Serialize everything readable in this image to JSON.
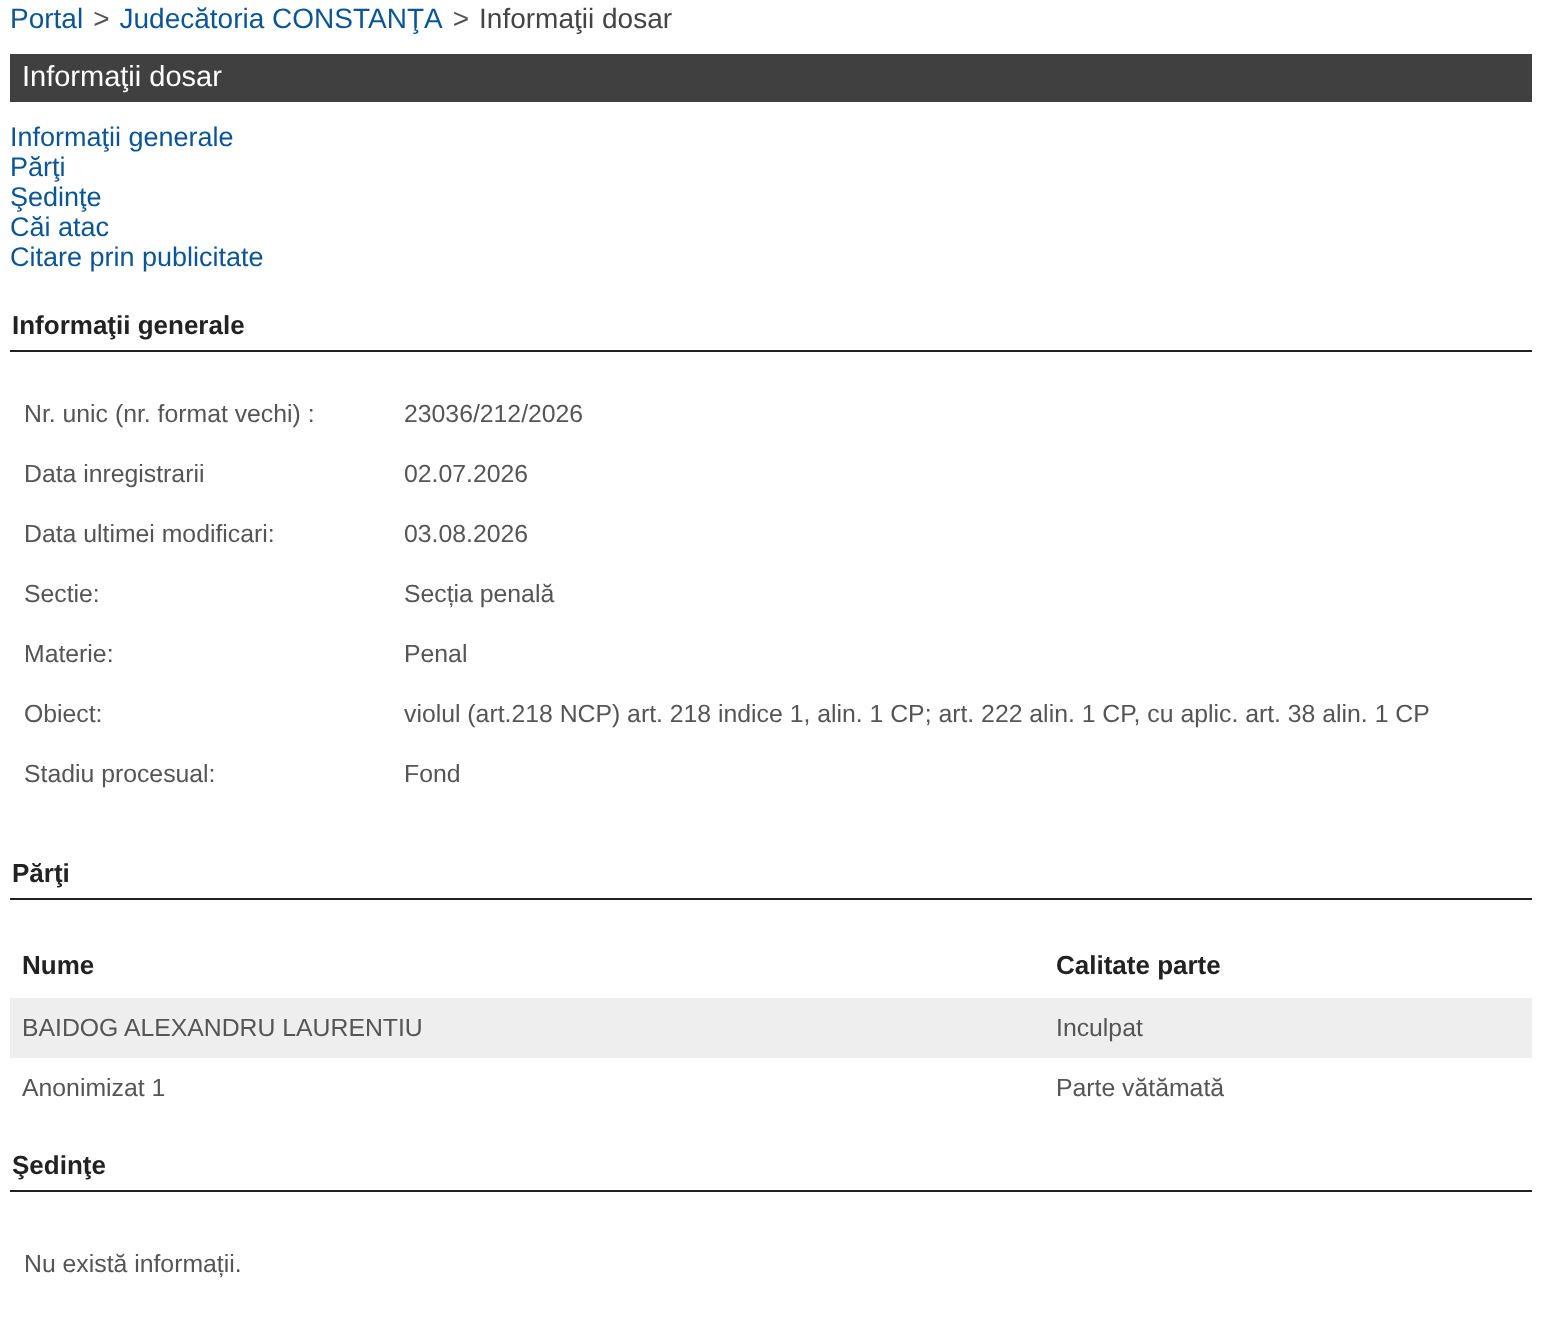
{
  "breadcrumb": [
    {
      "label": "Portal",
      "link": true
    },
    {
      "separator": ">",
      "label": "Judecătoria CONSTANŢA",
      "link": true
    },
    {
      "separator": ">",
      "label": "Informaţii dosar",
      "link": false
    }
  ],
  "title_bar": {
    "title": "Informaţii dosar"
  },
  "section_links": [
    "Informaţii generale",
    "Părţi",
    "Şedinţe",
    "Căi atac",
    "Citare prin publicitate"
  ],
  "general_info": {
    "heading": "Informaţii generale",
    "rows": [
      {
        "label": "Nr. unic (nr. format vechi) :",
        "value": "23036/212/2026"
      },
      {
        "label": "Data inregistrarii",
        "value": "02.07.2026"
      },
      {
        "label": "Data ultimei modificari:",
        "value": "03.08.2026"
      },
      {
        "label": "Sectie:",
        "value": "Secția penală"
      },
      {
        "label": "Materie:",
        "value": "Penal"
      },
      {
        "label": "Obiect:",
        "value": "violul (art.218 NCP) art. 218 indice 1, alin. 1 CP; art. 222 alin. 1 CP, cu aplic. art. 38 alin. 1 CP"
      },
      {
        "label": "Stadiu procesual:",
        "value": "Fond"
      }
    ]
  },
  "parties": {
    "heading": "Părţi",
    "columns": [
      "Nume",
      "Calitate parte"
    ],
    "rows": [
      {
        "cells": [
          "BAIDOG ALEXANDRU LAURENTIU",
          "Inculpat"
        ]
      },
      {
        "cells": [
          "Anonimizat 1",
          "Parte vătămată"
        ]
      }
    ]
  },
  "hearings": {
    "heading": "Şedinţe",
    "message": "Nu există informații."
  }
}
